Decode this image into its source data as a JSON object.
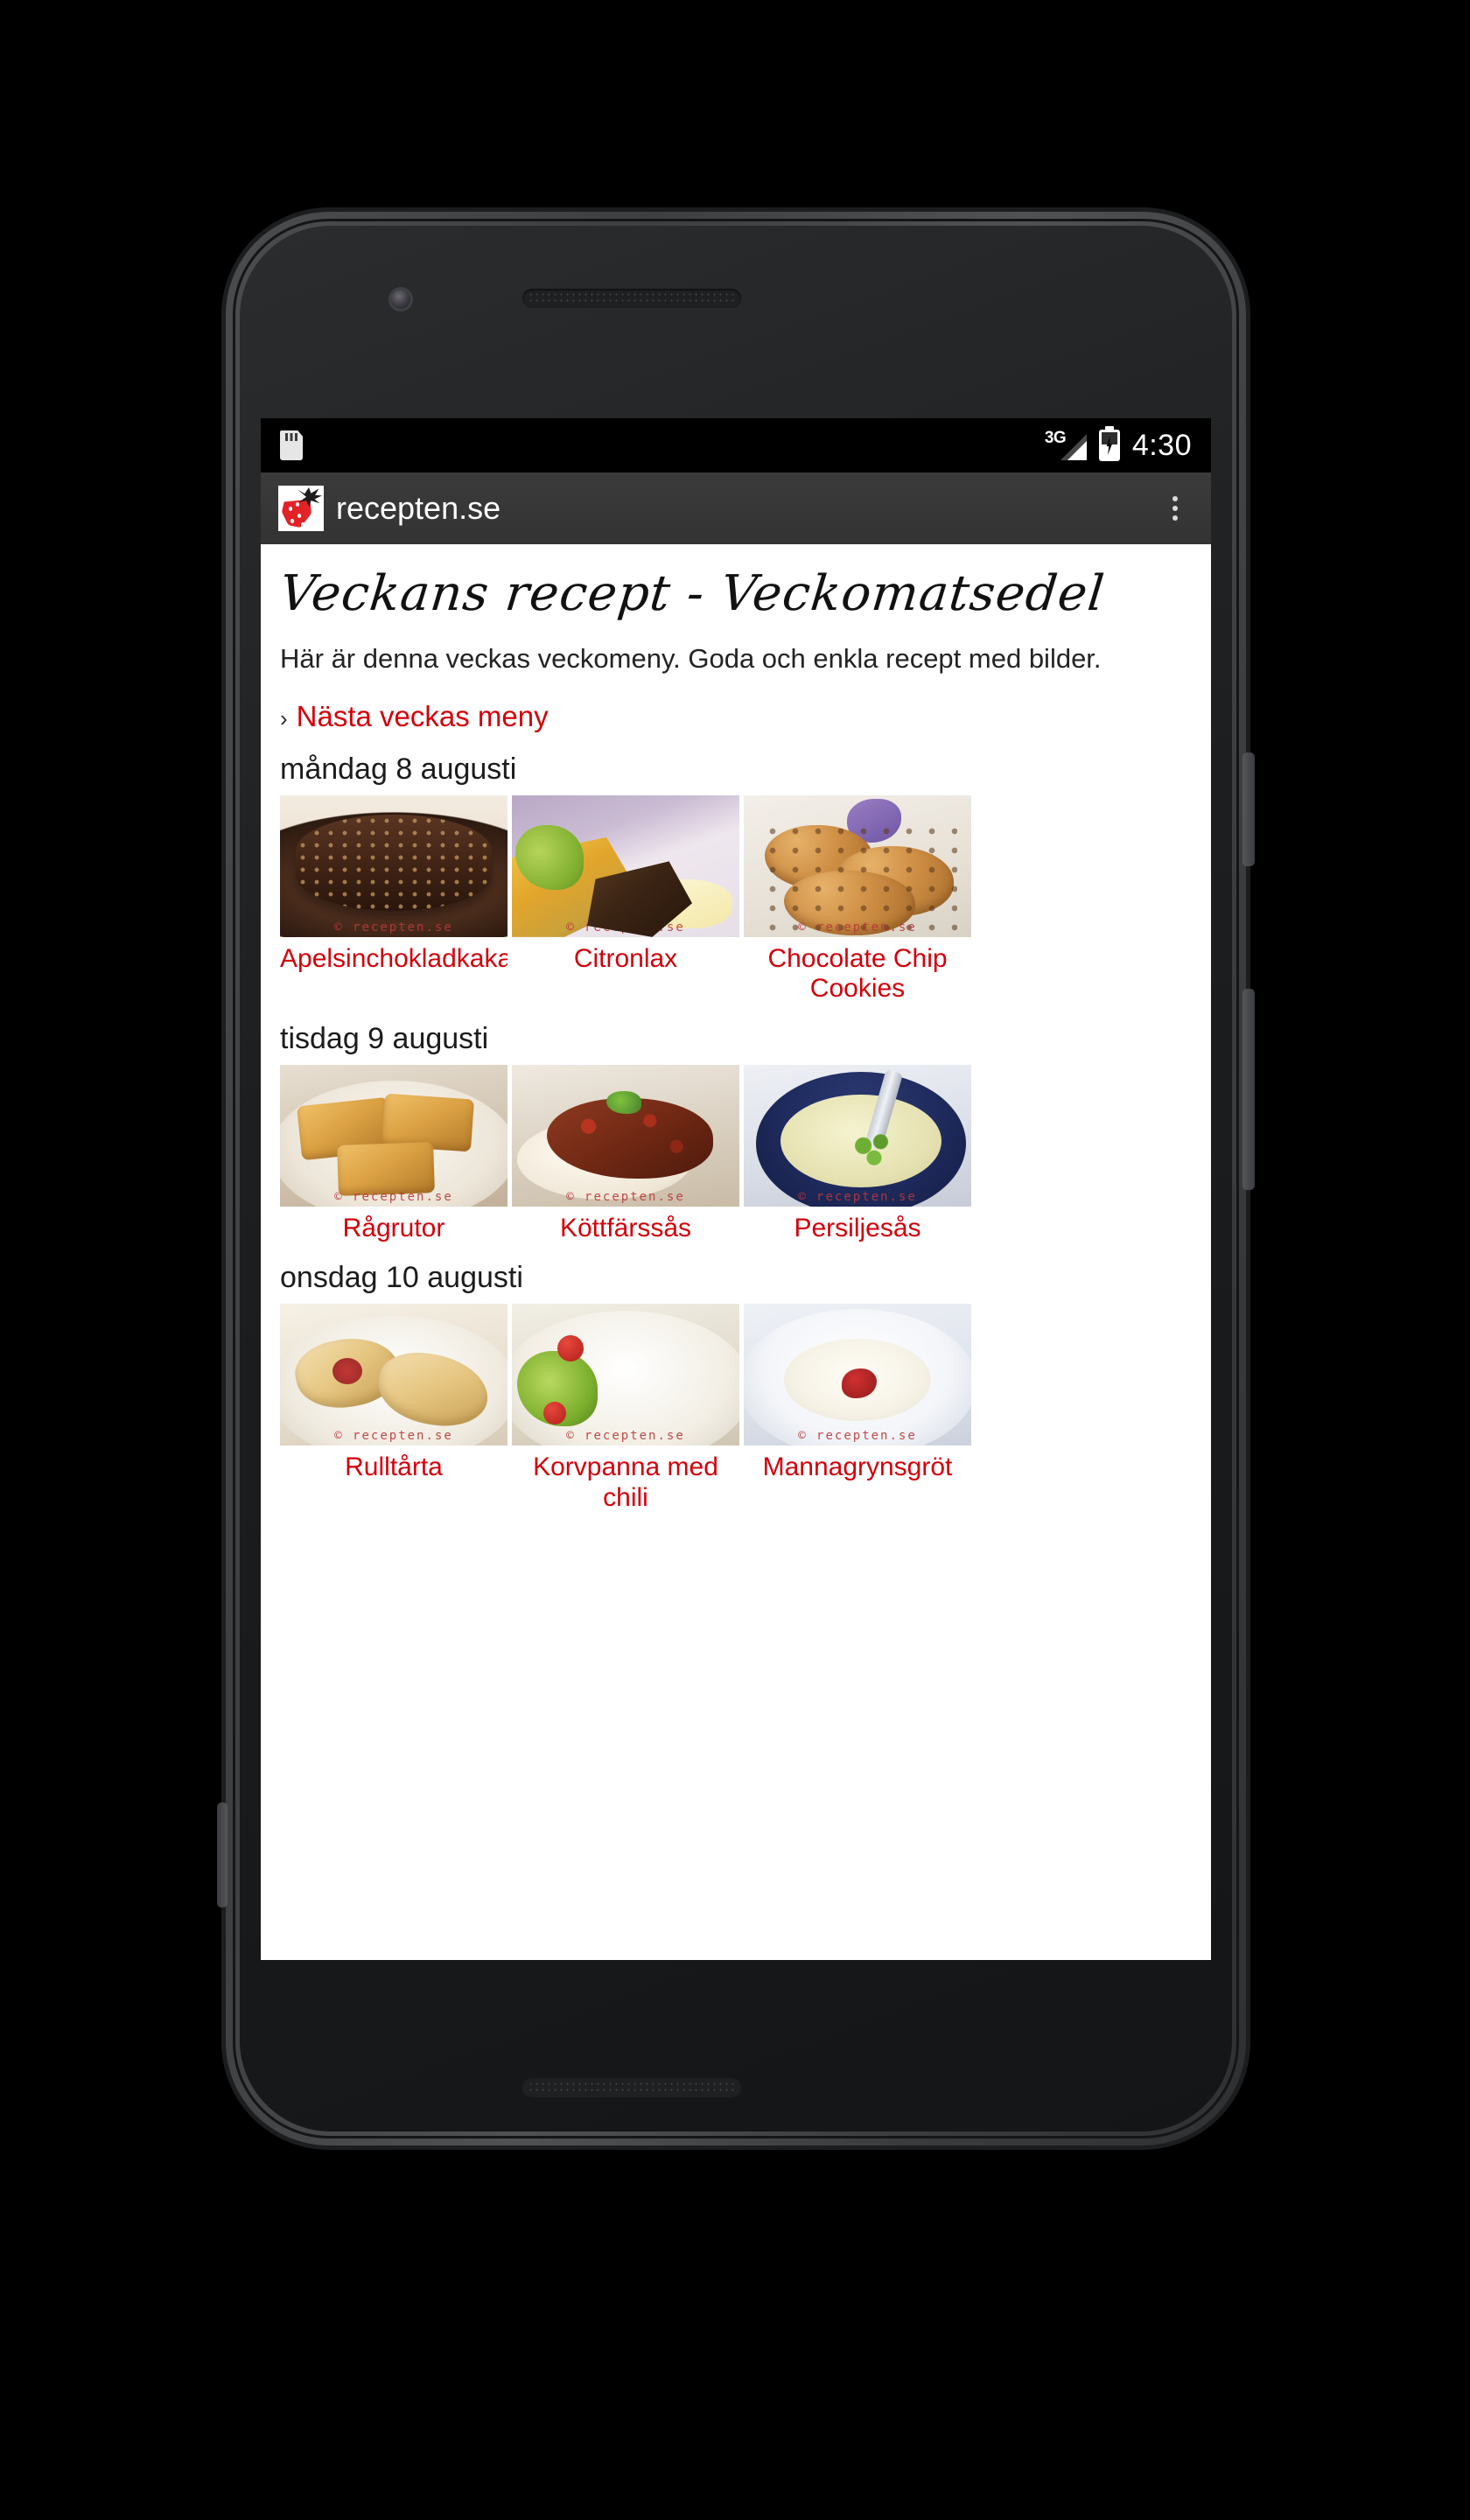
{
  "status_bar": {
    "sd_icon": "sdcard-icon",
    "network_label": "3G",
    "network_icon": "signal-3g-icon",
    "battery_icon": "battery-charging-icon",
    "time": "4:30"
  },
  "app_bar": {
    "logo_icon": "strawberry-logo-icon",
    "title": "recepten.se",
    "overflow_icon": "overflow-menu-icon"
  },
  "page": {
    "title": "Veckans recept - Veckomatsedel",
    "intro": "Här är denna veckas veckomeny. Goda och enkla recept med bilder.",
    "next_week_link": {
      "chevron": "›",
      "label": "Nästa veckas meny"
    },
    "watermark": "© recepten.se",
    "days": [
      {
        "heading": "måndag 8 augusti",
        "recipes": [
          {
            "name": "Apelsinchokladkaka",
            "thumb": "chocolate-orange-cake-thumb"
          },
          {
            "name": "Citronlax",
            "thumb": "lemon-salmon-thumb"
          },
          {
            "name": "Chocolate Chip Cookies",
            "thumb": "chocolate-chip-cookies-thumb"
          }
        ]
      },
      {
        "heading": "tisdag 9 augusti",
        "recipes": [
          {
            "name": "Rågrutor",
            "thumb": "rye-squares-thumb"
          },
          {
            "name": "Köttfärssås",
            "thumb": "minced-meat-sauce-thumb"
          },
          {
            "name": "Persiljesås",
            "thumb": "parsley-sauce-thumb"
          }
        ]
      },
      {
        "heading": "onsdag 10 augusti",
        "recipes": [
          {
            "name": "Rulltårta",
            "thumb": "swiss-roll-thumb"
          },
          {
            "name": "Korvpanna med chili",
            "thumb": "sausage-chili-pan-thumb"
          },
          {
            "name": "Mannagrynsgröt",
            "thumb": "semolina-porridge-thumb"
          }
        ]
      }
    ]
  },
  "nav_bar": {
    "back_icon": "back-triangle-icon",
    "home_icon": "home-circle-icon",
    "recents_icon": "recents-square-icon"
  },
  "colors": {
    "link_red": "#d3000a",
    "brand_red": "#e32227",
    "app_bar_bg": "#333333",
    "status_bar_bg": "#000000"
  }
}
